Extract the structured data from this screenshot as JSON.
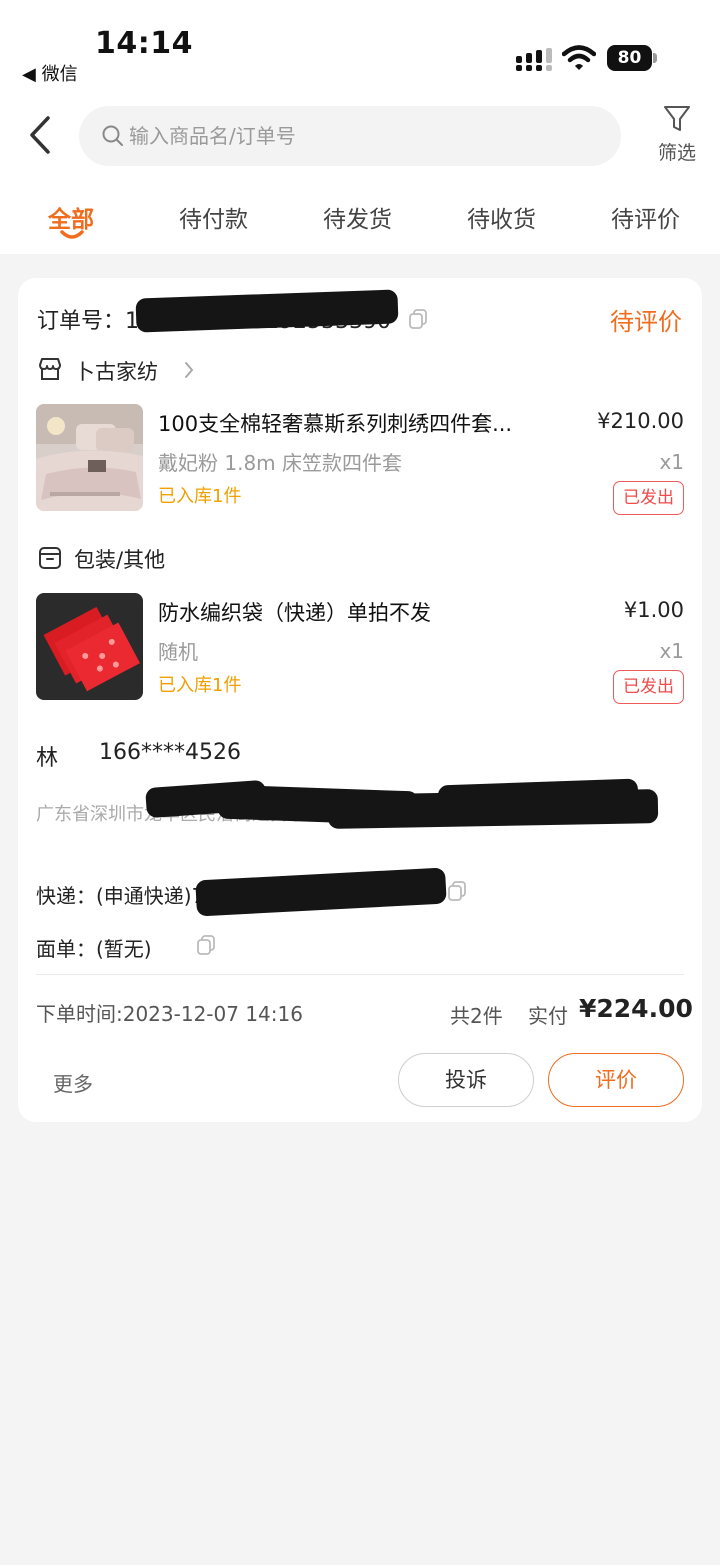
{
  "status_bar": {
    "time": "14:14",
    "back_app": "◀ 微信",
    "battery": "80"
  },
  "header": {
    "search_placeholder": "输入商品名/订单号",
    "filter_label": "筛选"
  },
  "tabs": [
    {
      "label": "全部",
      "active": true
    },
    {
      "label": "待付款",
      "active": false
    },
    {
      "label": "待发货",
      "active": false
    },
    {
      "label": "待收货",
      "active": false
    },
    {
      "label": "待评价",
      "active": false
    }
  ],
  "order": {
    "number_label": "订单号：",
    "number_visible": "1707552738192533390",
    "status": "待评价",
    "shop_name": "卜古家纺",
    "products": [
      {
        "title": "100支全棉轻奢慕斯系列刺绣四件套...",
        "spec": "戴妃粉 1.8m 床笠款四件套",
        "stock": "已入库1件",
        "price": "¥210.00",
        "qty": "x1",
        "badge": "已发出"
      },
      {
        "title": "防水编织袋（快递）单拍不发",
        "spec": "随机",
        "stock": "已入库1件",
        "price": "¥1.00",
        "qty": "x1",
        "badge": "已发出"
      }
    ],
    "group_name": "包装/其他",
    "receiver": {
      "name": "林",
      "phone": "166****4526",
      "address": "广东省深圳市龙华区民治街道民乐社区民乐花园二期6栋"
    },
    "express": "快递：(申通快递)773259231409082",
    "waybill": "面单：(暂无)",
    "order_time": "下单时间:2023-12-07 14:16",
    "count": "共2件",
    "paid_label": "实付",
    "paid_amount": "¥224.00",
    "more": "更多",
    "btn_complain": "投诉",
    "btn_review": "评价"
  },
  "colors": {
    "accent": "#f06c1e",
    "stock": "#f0a000",
    "badge": "#ef4b4b"
  }
}
